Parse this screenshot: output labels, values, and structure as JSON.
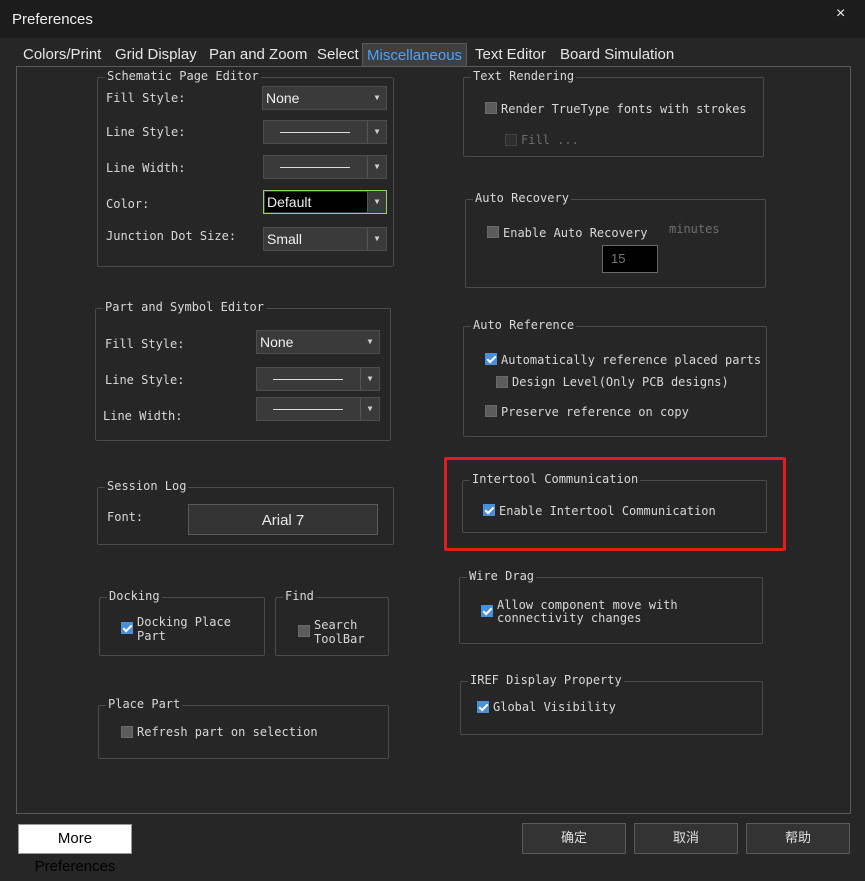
{
  "window": {
    "title": "Preferences",
    "close_glyph": "×"
  },
  "tabs": [
    "Colors/Print",
    "Grid Display",
    "Pan and Zoom",
    "Select",
    "Miscellaneous",
    "Text Editor",
    "Board Simulation"
  ],
  "active_tab": "Miscellaneous",
  "schematic": {
    "title": "Schematic Page Editor",
    "fill_label": "Fill Style:",
    "fill_value": "None",
    "line_style_label": "Line Style:",
    "line_width_label": "Line Width:",
    "color_label": "Color:",
    "color_value": "Default",
    "junction_label": "Junction Dot Size:",
    "junction_value": "Small"
  },
  "part_symbol": {
    "title": "Part and Symbol Editor",
    "fill_label": "Fill Style:",
    "fill_value": "None",
    "line_style_label": "Line Style:",
    "line_width_label": "Line Width:"
  },
  "session_log": {
    "title": "Session Log",
    "font_label": "Font:",
    "font_value": "Arial 7"
  },
  "docking": {
    "title": "Docking",
    "option": "Docking Place Part",
    "checked": true
  },
  "find": {
    "title": "Find",
    "option": "Search ToolBar",
    "checked": false
  },
  "place_part": {
    "title": "Place Part",
    "option": "Refresh part on selection",
    "checked": false
  },
  "text_rendering": {
    "title": "Text Rendering",
    "truetype": "Render TrueType fonts with strokes",
    "fill": "Fill ..."
  },
  "auto_recovery": {
    "title": "Auto Recovery",
    "enable": "Enable Auto Recovery",
    "minutes_label": "minutes",
    "minutes_value": "15"
  },
  "auto_reference": {
    "title": "Auto Reference",
    "auto": "Automatically reference placed parts",
    "design": "Design Level(Only PCB designs)",
    "preserve": "Preserve reference on copy"
  },
  "intertool": {
    "title": "Intertool Communication",
    "enable": "Enable Intertool Communication"
  },
  "wire_drag": {
    "title": "Wire Drag",
    "line1": "Allow component move with",
    "line2": "connectivity changes"
  },
  "iref": {
    "title": "IREF Display Property",
    "global": "Global Visibility"
  },
  "buttons": {
    "more": "More Preferences",
    "ok": "确定",
    "cancel": "取消",
    "help": "帮助"
  },
  "colors": {
    "accent_tab": "#4aa3ff",
    "highlight": "#e11d1d",
    "checkbox_on": "#4a90d9"
  }
}
